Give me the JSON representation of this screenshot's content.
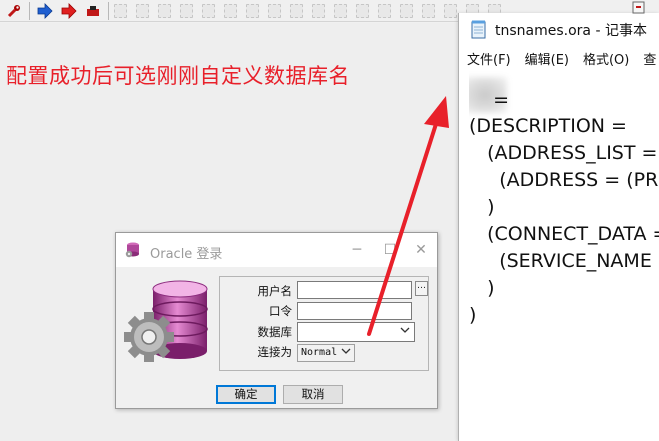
{
  "annotation": "配置成功后可选刚刚自定义数据库名",
  "toolbar": {
    "icons": [
      "wrench-run-icon",
      "arrow-right-blue-icon",
      "arrow-right-red-icon",
      "stop-icon"
    ]
  },
  "dialog": {
    "title": "Oracle 登录",
    "controls": {
      "minimize": "─",
      "maximize": "☐",
      "close": "✕"
    },
    "labels": {
      "username": "用户名",
      "password": "口令",
      "database": "数据库",
      "connect_as": "连接为"
    },
    "fields": {
      "username_value": "",
      "password_value": "",
      "database_value": "",
      "connect_as_value": "Normal"
    },
    "ellipsis": "…",
    "buttons": {
      "ok": "确定",
      "cancel": "取消"
    }
  },
  "notepad": {
    "title": "tnsnames.ora - 记事本",
    "menu": [
      "文件(F)",
      "编辑(E)",
      "格式(O)",
      "查"
    ],
    "lines": [
      "    =",
      "(DESCRIPTION =",
      "   (ADDRESS_LIST =",
      "     (ADDRESS = (PROT",
      "   )",
      "   (CONNECT_DATA =",
      "     (SERVICE_NAME =",
      "   )",
      ")"
    ]
  },
  "colors": {
    "annotation": "#e8202a",
    "focus_border": "#0078d7",
    "arrow": "#e8202a"
  }
}
